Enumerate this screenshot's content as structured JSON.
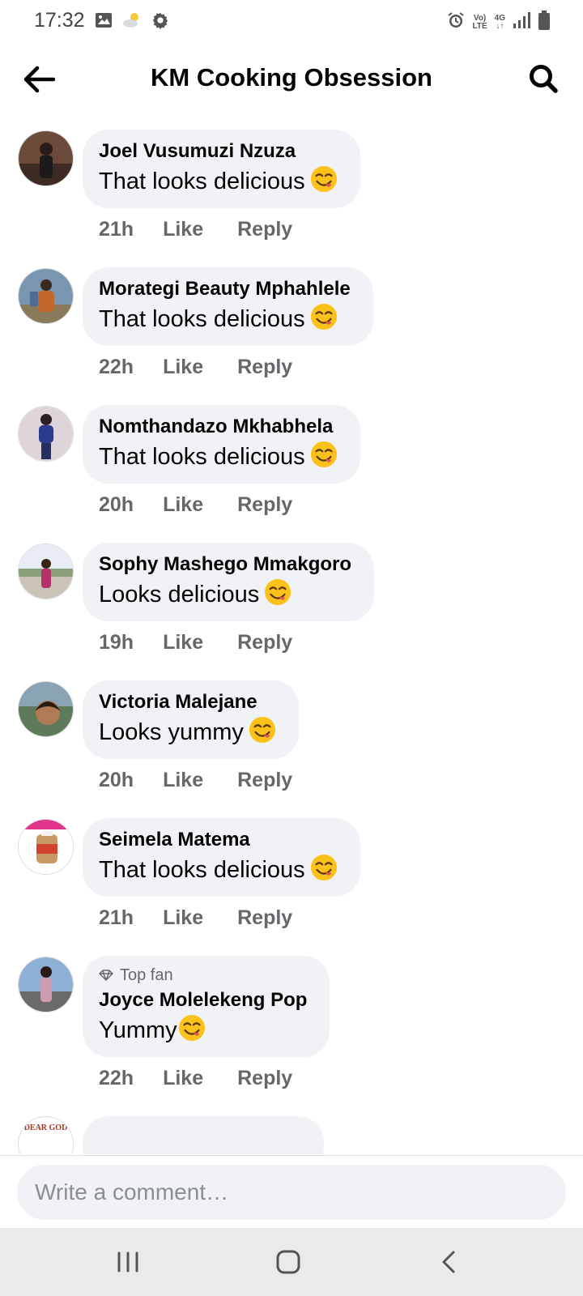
{
  "status_bar": {
    "time": "17:32",
    "left_icons": [
      "image-icon",
      "weather-icon",
      "settings-icon"
    ],
    "right_icons": [
      "alarm-icon",
      "volte-icon",
      "network-4g-icon",
      "signal-icon",
      "battery-icon"
    ],
    "volte_top": "Vo)",
    "volte_bottom": "LTE",
    "network_top": "4G",
    "network_bottom": "↓↑"
  },
  "header": {
    "title": "KM Cooking Obsession"
  },
  "comments": [
    {
      "author": "Joel Vusumuzi Nzuza",
      "text": "That looks delicious",
      "time": "21h",
      "like": "Like",
      "reply": "Reply"
    },
    {
      "author": "Morategi Beauty Mphahlele",
      "text": "That looks delicious",
      "time": "22h",
      "like": "Like",
      "reply": "Reply"
    },
    {
      "author": "Nomthandazo Mkhabhela",
      "text": "That looks delicious",
      "time": "20h",
      "like": "Like",
      "reply": "Reply"
    },
    {
      "author": "Sophy Mashego Mmakgoro",
      "text": "Looks delicious",
      "time": "19h",
      "like": "Like",
      "reply": "Reply"
    },
    {
      "author": "Victoria Malejane",
      "text": "Looks yummy",
      "time": "20h",
      "like": "Like",
      "reply": "Reply"
    },
    {
      "author": "Seimela Matema",
      "text": "That looks delicious",
      "time": "21h",
      "like": "Like",
      "reply": "Reply"
    },
    {
      "badge": "Top fan",
      "author": "Joyce Molelekeng Pop",
      "text": "Yummy",
      "time": "22h",
      "like": "Like",
      "reply": "Reply"
    }
  ],
  "partial_comment": {
    "avatar_text": "DEAR GOD"
  },
  "composer": {
    "placeholder": "Write a comment…"
  },
  "colors": {
    "bubble": "#f0f2f5",
    "meta_text": "#65676b",
    "primary_text": "#050505",
    "nav_bar": "#e9eaec"
  }
}
